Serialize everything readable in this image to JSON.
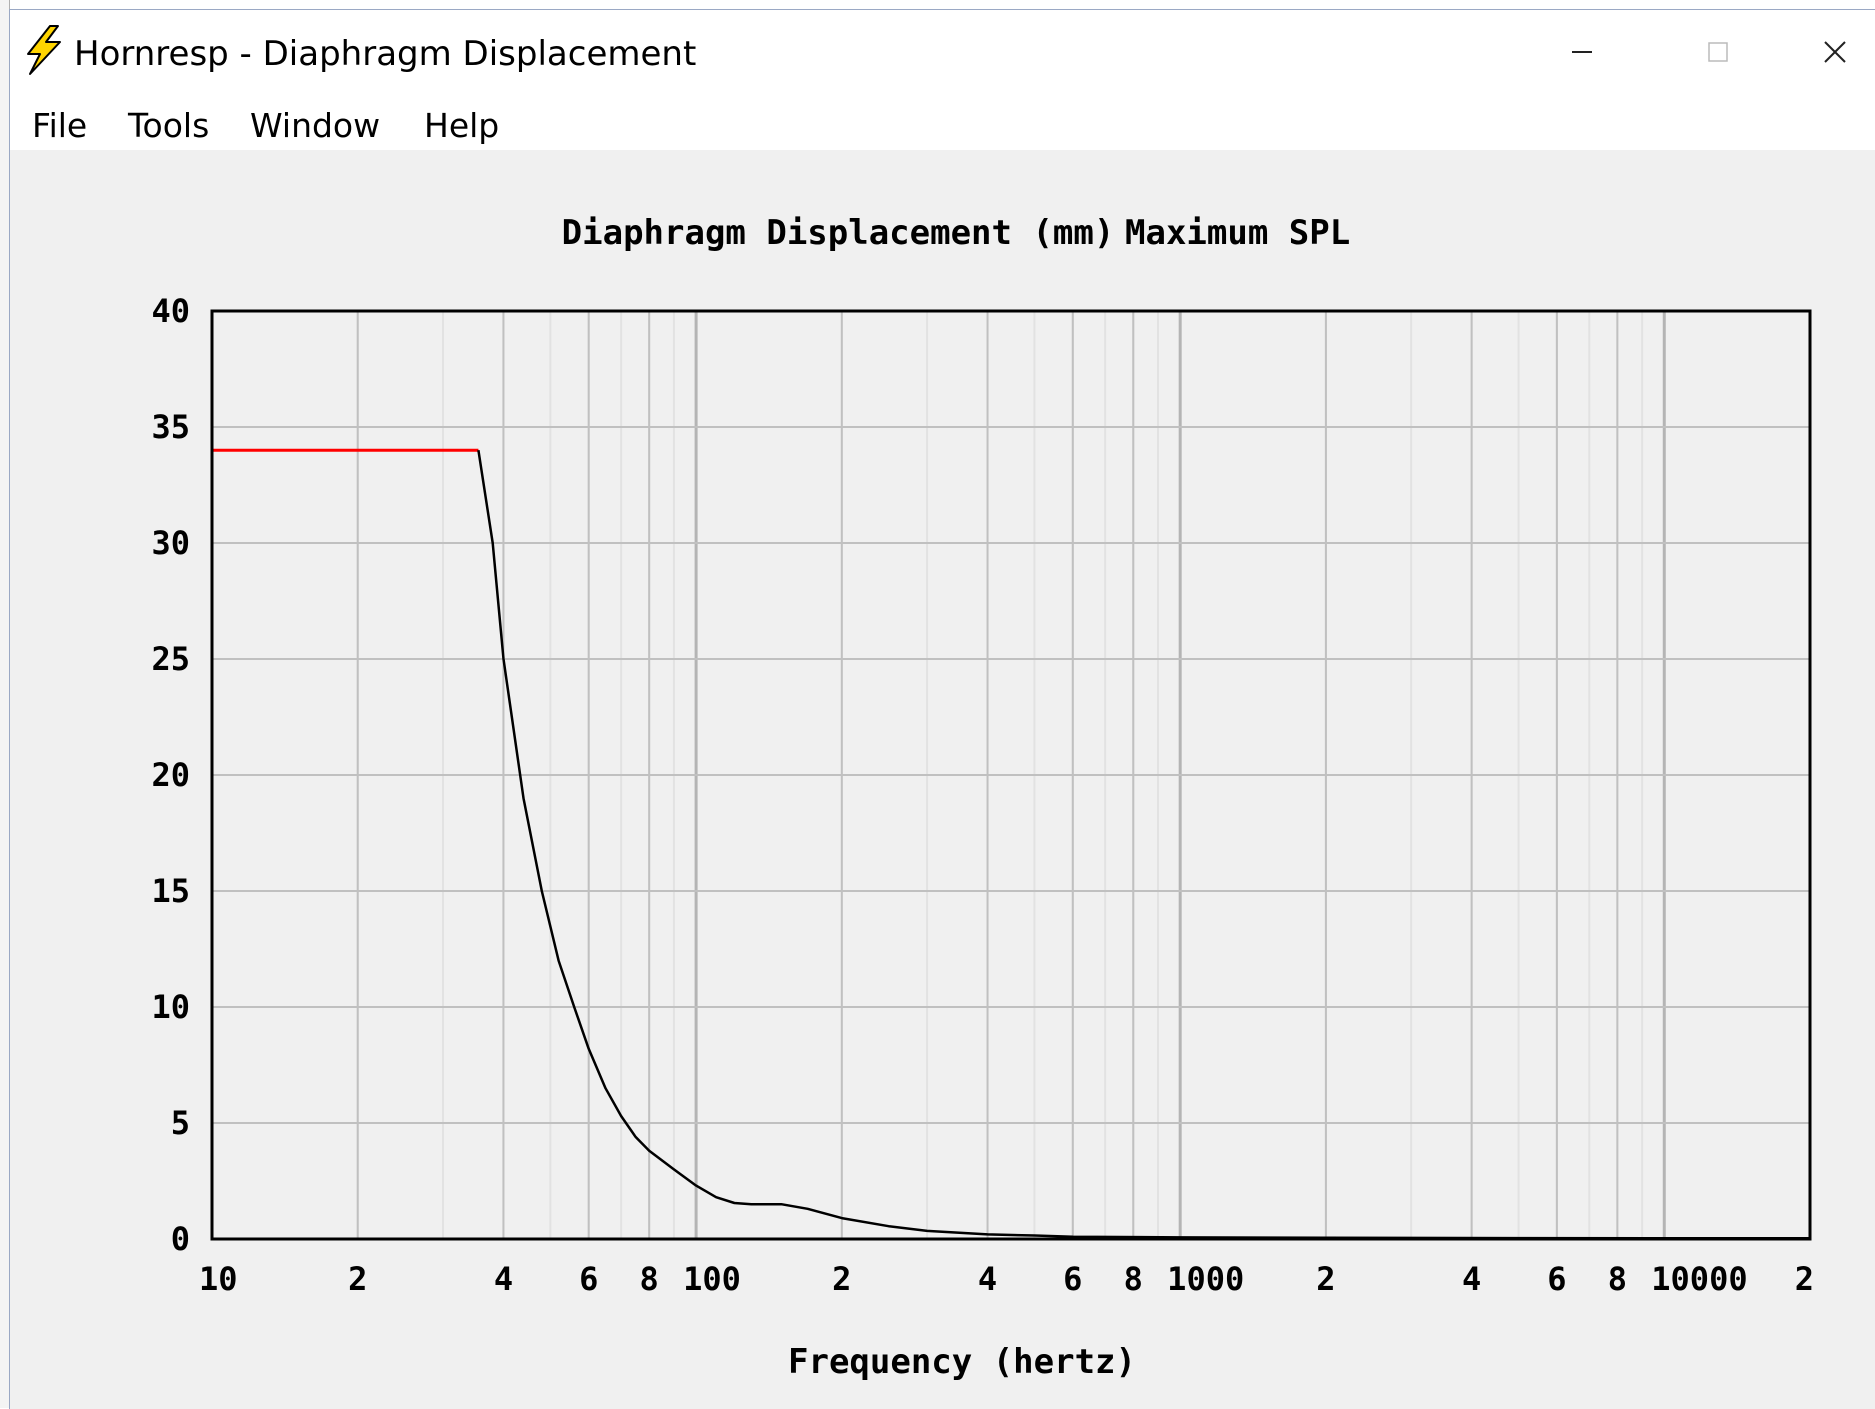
{
  "window": {
    "title": "Hornresp - Diaphragm Displacement",
    "icon": "lightning-bolt-icon",
    "controls": [
      "minimize-icon",
      "maximize-icon",
      "close-icon"
    ]
  },
  "menu": {
    "items": [
      {
        "label": "File"
      },
      {
        "label": "Tools"
      },
      {
        "label": "Window"
      },
      {
        "label": "Help"
      }
    ]
  },
  "chart": {
    "title": "Diaphragm Displacement (mm)",
    "subtitle": "Maximum SPL",
    "xlabel": "Frequency (hertz)"
  },
  "chart_data": {
    "type": "line",
    "title": "Diaphragm Displacement (mm)",
    "subtitle": "Maximum SPL",
    "xlabel": "Frequency (hertz)",
    "ylabel": "",
    "x_scale": "log",
    "xlim": [
      10,
      20000
    ],
    "ylim": [
      0,
      40
    ],
    "grid": true,
    "x_tick_labels": [
      {
        "value": 10,
        "label": "10"
      },
      {
        "value": 20,
        "label": "2"
      },
      {
        "value": 40,
        "label": "4"
      },
      {
        "value": 60,
        "label": "6"
      },
      {
        "value": 80,
        "label": "8"
      },
      {
        "value": 100,
        "label": "100"
      },
      {
        "value": 200,
        "label": "2"
      },
      {
        "value": 400,
        "label": "4"
      },
      {
        "value": 600,
        "label": "6"
      },
      {
        "value": 800,
        "label": "8"
      },
      {
        "value": 1000,
        "label": "1000"
      },
      {
        "value": 2000,
        "label": "2"
      },
      {
        "value": 4000,
        "label": "4"
      },
      {
        "value": 6000,
        "label": "6"
      },
      {
        "value": 8000,
        "label": "8"
      },
      {
        "value": 10000,
        "label": "10000"
      },
      {
        "value": 20000,
        "label": "2"
      }
    ],
    "y_ticks": [
      0,
      5,
      10,
      15,
      20,
      25,
      30,
      35,
      40
    ],
    "colors": {
      "limit": "#ff0000",
      "curve": "#000000",
      "grid": "#c0c0c0",
      "minor_grid": "#e2e2e2"
    },
    "series": [
      {
        "x": [
          10,
          35.5
        ],
        "y": [
          34,
          34
        ]
      },
      {
        "x": [
          35.5,
          38,
          40,
          44,
          48,
          52,
          56,
          60,
          65,
          70,
          75,
          80,
          90,
          100,
          110,
          120,
          130,
          150,
          170,
          200,
          250,
          300,
          400,
          500,
          600,
          1000,
          2000,
          5000,
          10000,
          20000
        ],
        "y": [
          34,
          30,
          25,
          19,
          15,
          12,
          10,
          8.2,
          6.5,
          5.3,
          4.4,
          3.8,
          3.0,
          2.3,
          1.8,
          1.55,
          1.5,
          1.5,
          1.3,
          0.9,
          0.55,
          0.35,
          0.2,
          0.15,
          0.1,
          0.07,
          0.05,
          0.04,
          0.03,
          0.03
        ]
      }
    ]
  }
}
